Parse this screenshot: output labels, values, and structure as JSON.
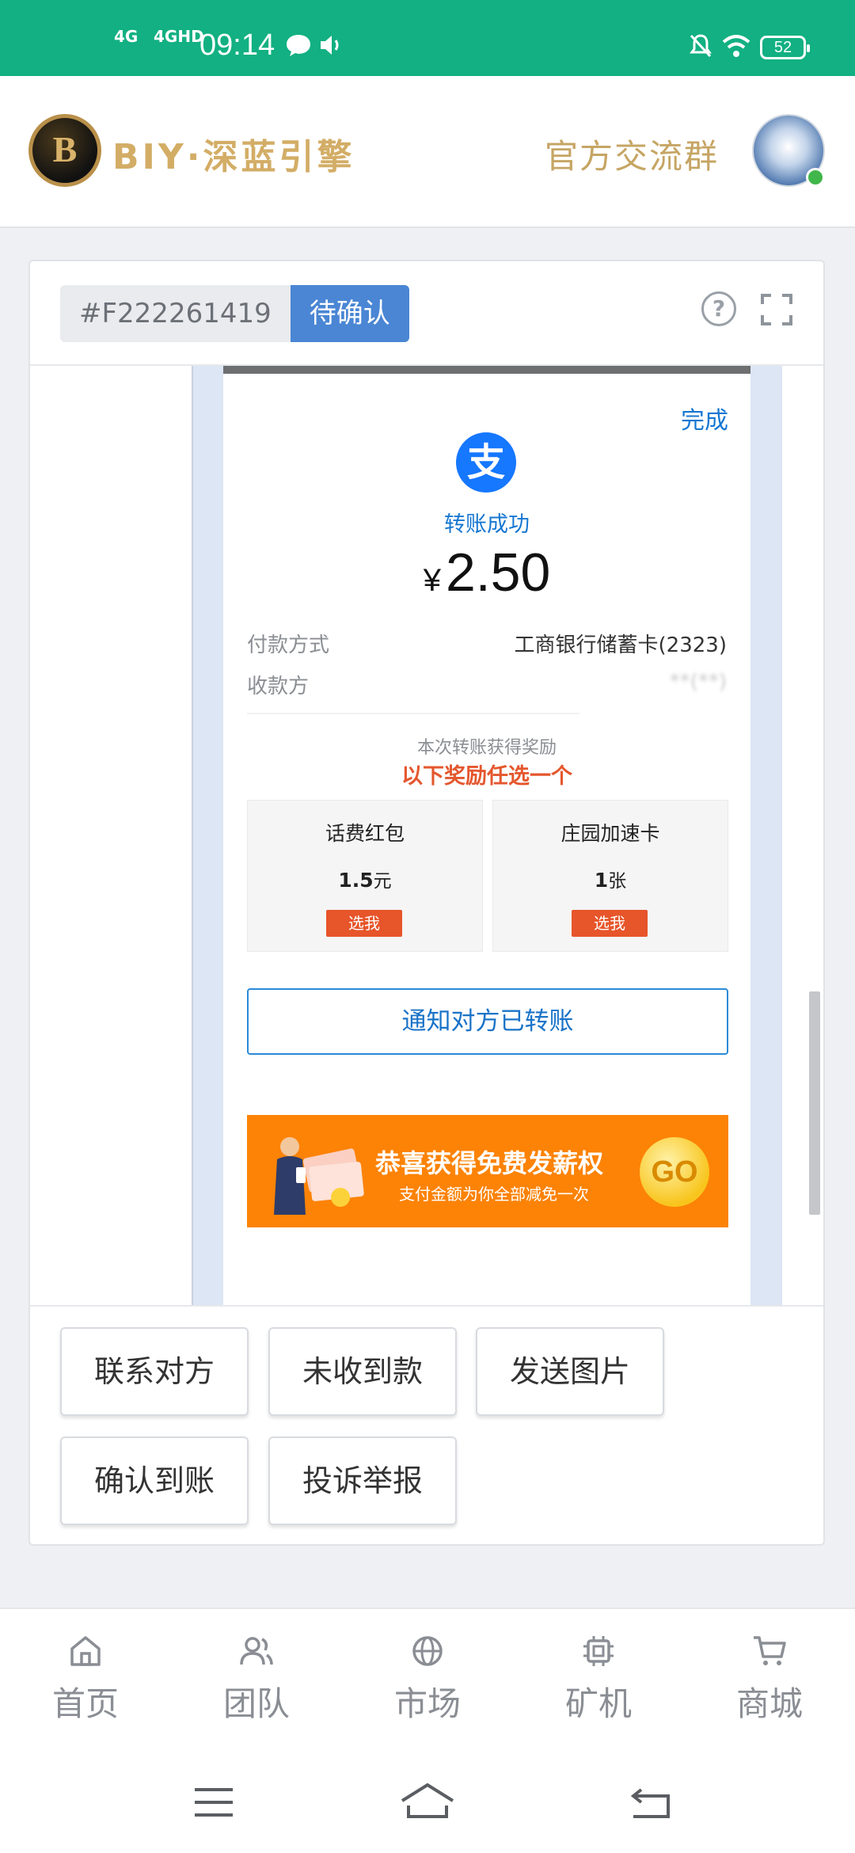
{
  "status_bar": {
    "network_1": "4G",
    "network_2": "4GHD",
    "time": "09:14",
    "battery": "52"
  },
  "header": {
    "brand_name": "BIY·深蓝引擎",
    "group_link": "官方交流群",
    "logo_icon": "coin-logo-icon",
    "avatar_icon": "dragon-avatar-icon"
  },
  "order": {
    "order_no": "#F222261419",
    "status": "待确认"
  },
  "receipt": {
    "done_label": "完成",
    "success_text": "转账成功",
    "currency": "¥",
    "amount": "2.50",
    "payment_method_label": "付款方式",
    "payment_method_value": "工商银行储蓄卡(2323)",
    "payee_label": "收款方",
    "payee_value": "**(**)",
    "reward_hint": "本次转账获得奖励",
    "reward_title": "以下奖励任选一个",
    "rewards": [
      {
        "title": "话费红包",
        "amount": "1.5",
        "unit": "元",
        "button": "选我"
      },
      {
        "title": "庄园加速卡",
        "amount": "1",
        "unit": "张",
        "button": "选我"
      }
    ],
    "notify_button": "通知对方已转账",
    "banner_title": "恭喜获得免费发薪权",
    "banner_subtitle": "支付金额为你全部减免一次",
    "banner_go": "GO"
  },
  "actions": [
    "联系对方",
    "未收到款",
    "发送图片",
    "确认到账",
    "投诉举报"
  ],
  "tabs": [
    {
      "label": "首页",
      "icon": "home-icon"
    },
    {
      "label": "团队",
      "icon": "team-icon"
    },
    {
      "label": "市场",
      "icon": "globe-icon"
    },
    {
      "label": "矿机",
      "icon": "chip-icon"
    },
    {
      "label": "商城",
      "icon": "cart-icon"
    }
  ],
  "colors": {
    "status_bar": "#12b082",
    "brand_gold": "#d3ad66",
    "status_tag": "#4a86d4",
    "alipay_blue": "#1677ff",
    "reward_red": "#e7552a",
    "banner_orange": "#fc8306"
  }
}
